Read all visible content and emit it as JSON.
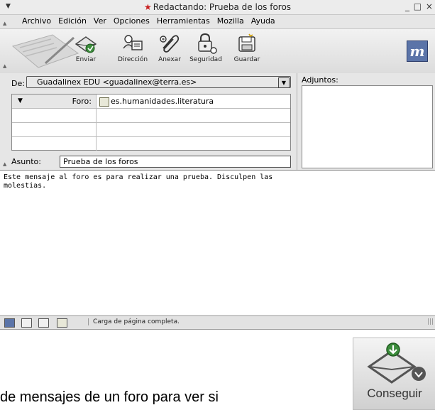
{
  "window": {
    "title": "Redactando: Prueba de los foros",
    "controls": "_ □ ×"
  },
  "menu": {
    "items": [
      "Archivo",
      "Edición",
      "Ver",
      "Opciones",
      "Herramientas",
      "Mozilla",
      "Ayuda"
    ]
  },
  "toolbar": {
    "buttons": [
      {
        "label": "Enviar",
        "icon": "send-icon"
      },
      {
        "label": "Dirección",
        "icon": "address-book-icon"
      },
      {
        "label": "Anexar",
        "icon": "attach-paperclip-icon"
      },
      {
        "label": "Seguridad",
        "icon": "security-lock-icon"
      },
      {
        "label": "Guardar",
        "icon": "save-disk-icon"
      }
    ],
    "logo_text": "m"
  },
  "compose": {
    "from_label": "De:",
    "from_value": "Guadalinex EDU <guadalinex@terra.es>",
    "recipients": [
      {
        "type": "Foro:",
        "address": "es.humanidades.literatura"
      }
    ],
    "subject_label": "Asunto:",
    "subject_value": "Prueba de los foros",
    "attachments_label": "Adjuntos:",
    "body": "Este mensaje al foro es para realizar una prueba. Disculpen las\nmolestias."
  },
  "statusbar": {
    "text": "Carga de página completa."
  },
  "page": {
    "lower_text": "de mensajes de un foro para ver si",
    "conseguir_label": "Conseguir"
  },
  "colors": {
    "title_star": "#c81e1e",
    "logo": "#5b74a8",
    "window_bg": "#e6e6e6"
  }
}
